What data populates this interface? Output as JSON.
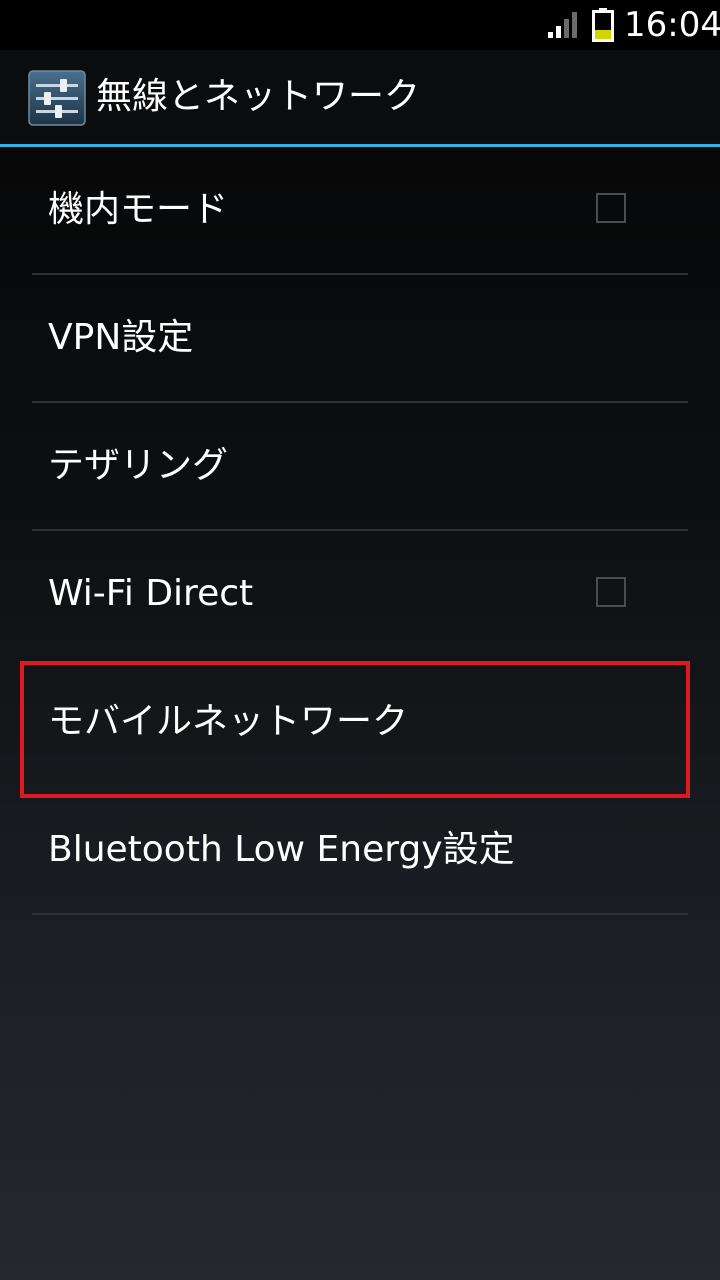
{
  "status_bar": {
    "time": "16:04",
    "signal_icon": "cell-signal-icon",
    "battery_icon": "battery-icon",
    "battery_color": "#d4d400"
  },
  "action_bar": {
    "icon": "settings-sliders-icon",
    "title": "無線とネットワーク",
    "underline_color": "#33b5e5"
  },
  "list": {
    "items": [
      {
        "label": "機内モード",
        "has_checkbox": true,
        "checked": false
      },
      {
        "label": "VPN設定",
        "has_checkbox": false
      },
      {
        "label": "テザリング",
        "has_checkbox": false
      },
      {
        "label": "Wi-Fi Direct",
        "has_checkbox": true,
        "checked": false
      },
      {
        "label": "モバイルネットワーク",
        "has_checkbox": false,
        "highlighted": true
      },
      {
        "label": "Bluetooth Low Energy設定",
        "has_checkbox": false
      }
    ]
  },
  "highlight_color": "#e0191f"
}
